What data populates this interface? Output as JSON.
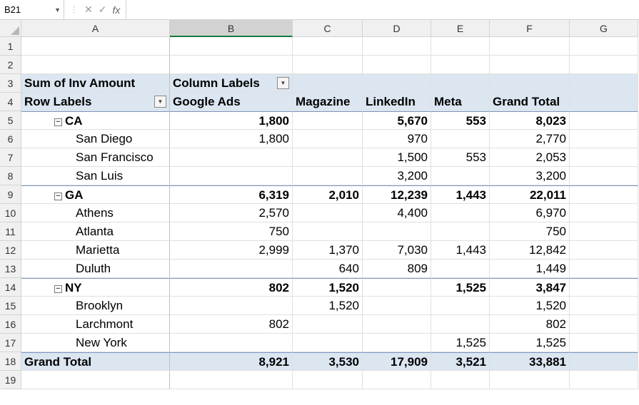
{
  "name_box": "B21",
  "formula_value": "",
  "columns": [
    "A",
    "B",
    "C",
    "D",
    "E",
    "F",
    "G"
  ],
  "row_count": 19,
  "selected": {
    "row": 21,
    "col": "B"
  },
  "labels": {
    "sum_of": "Sum of Inv Amount",
    "column_labels": "Column Labels",
    "row_labels": "Row Labels",
    "grand_total": "Grand Total",
    "toggle": "−"
  },
  "col_headers": [
    "Google Ads",
    "Magazine",
    "LinkedIn",
    "Meta",
    "Grand Total"
  ],
  "groups": [
    {
      "name": "CA",
      "totals": [
        "1,800",
        "",
        "5,670",
        "553",
        "8,023"
      ],
      "rows": [
        {
          "name": "San Diego",
          "vals": [
            "1,800",
            "",
            "970",
            "",
            "2,770"
          ]
        },
        {
          "name": "San Francisco",
          "vals": [
            "",
            "",
            "1,500",
            "553",
            "2,053"
          ]
        },
        {
          "name": "San Luis",
          "vals": [
            "",
            "",
            "3,200",
            "",
            "3,200"
          ]
        }
      ]
    },
    {
      "name": "GA",
      "totals": [
        "6,319",
        "2,010",
        "12,239",
        "1,443",
        "22,011"
      ],
      "rows": [
        {
          "name": "Athens",
          "vals": [
            "2,570",
            "",
            "4,400",
            "",
            "6,970"
          ]
        },
        {
          "name": "Atlanta",
          "vals": [
            "750",
            "",
            "",
            "",
            "750"
          ]
        },
        {
          "name": "Marietta",
          "vals": [
            "2,999",
            "1,370",
            "7,030",
            "1,443",
            "12,842"
          ]
        },
        {
          "name": "Duluth",
          "vals": [
            "",
            "640",
            "809",
            "",
            "1,449"
          ]
        }
      ]
    },
    {
      "name": "NY",
      "totals": [
        "802",
        "1,520",
        "",
        "1,525",
        "3,847"
      ],
      "rows": [
        {
          "name": "Brooklyn",
          "vals": [
            "",
            "1,520",
            "",
            "",
            "1,520"
          ]
        },
        {
          "name": "Larchmont",
          "vals": [
            "802",
            "",
            "",
            "",
            "802"
          ]
        },
        {
          "name": "New York",
          "vals": [
            "",
            "",
            "",
            "1,525",
            "1,525"
          ]
        }
      ]
    }
  ],
  "grand_totals": [
    "8,921",
    "3,530",
    "17,909",
    "3,521",
    "33,881"
  ]
}
